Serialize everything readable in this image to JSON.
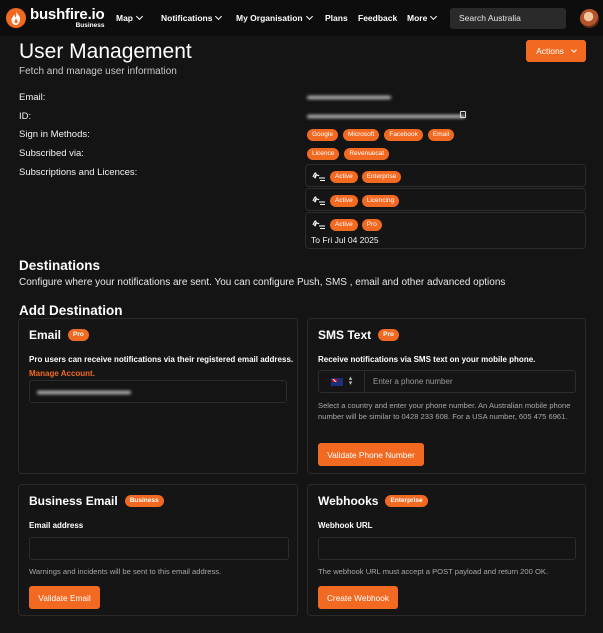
{
  "brand": {
    "name": "bushfire.io",
    "tier": "Business"
  },
  "nav": {
    "map": "Map",
    "notifications": "Notifications",
    "organisation": "My Organisation",
    "plans": "Plans",
    "feedback": "Feedback",
    "more": "More"
  },
  "search": {
    "placeholder": "Search Australia"
  },
  "header": {
    "title": "User Management",
    "subtitle": "Fetch and manage user information",
    "actions": "Actions"
  },
  "info": {
    "email_label": "Email:",
    "id_label": "ID:",
    "signin_label": "Sign in Methods:",
    "signin_methods": [
      "Google",
      "Microsoft",
      "Facebook",
      "Email"
    ],
    "subscribed_label": "Subscribed via:",
    "subscribed_via": [
      "Licence",
      "Revenuecat"
    ],
    "subs_label": "Subscriptions and Licences:",
    "subscriptions": [
      {
        "status": "Active",
        "plan": "Enterprise",
        "note": ""
      },
      {
        "status": "Active",
        "plan": "Licencing",
        "note": ""
      },
      {
        "status": "Active",
        "plan": "Pro",
        "note": "To Fri Jul 04 2025"
      }
    ]
  },
  "destinations": {
    "title": "Destinations",
    "description": "Configure where your notifications are sent. You can configure Push, SMS , email and other advanced options",
    "add_title": "Add Destination"
  },
  "email_card": {
    "title": "Email",
    "badge": "Pro",
    "desc": "Pro users can receive notifications via their registered email address.",
    "manage": "Manage Account."
  },
  "sms_card": {
    "title": "SMS Text",
    "badge": "Pro",
    "desc": "Receive notifications via SMS text on your mobile phone.",
    "placeholder": "Enter a phone number",
    "note": "Select a country and enter your phone number. An Australian mobile phone number will be similar to 0428 233 608. For a USA number, 605 475 6961.",
    "button": "Validate Phone Number"
  },
  "business_card": {
    "title": "Business Email",
    "badge": "Business",
    "field_label": "Email address",
    "note": "Warnings and incidents will be sent to this email address.",
    "button": "Validate Email"
  },
  "webhook_card": {
    "title": "Webhooks",
    "badge": "Enterprise",
    "field_label": "Webhook URL",
    "note": "The webhook URL must accept a POST payload and return 200 OK.",
    "button": "Create Webhook"
  }
}
